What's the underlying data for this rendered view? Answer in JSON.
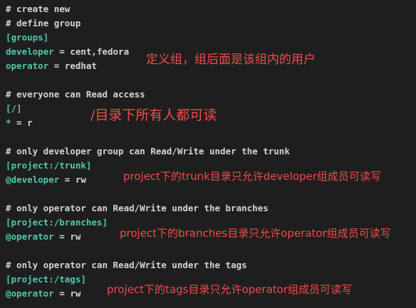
{
  "code": {
    "line_1": "# create new",
    "line_2": "# define group",
    "line_3": "[groups]",
    "line_4_key": "developer",
    "line_4_op": " = ",
    "line_4_val": "cent,fedora",
    "line_5_key": "operator",
    "line_5_op": " = ",
    "line_5_val": "redhat",
    "line_7": "# everyone can Read access",
    "line_8": "[/]",
    "line_9_key": "*",
    "line_9_op": " = ",
    "line_9_val": "r",
    "line_11": "# only developer group can Read/Write under the trunk",
    "line_12": "[project:/trunk]",
    "line_13_key": "@developer",
    "line_13_op": " = ",
    "line_13_val": "rw",
    "line_15": "# only operator can Read/Write under the branches",
    "line_16": "[project:/branches]",
    "line_17_key": "@operator",
    "line_17_op": " = ",
    "line_17_val": "rw",
    "line_19": "# only operator can Read/Write under the tags",
    "line_20": "[project:/tags]",
    "line_21_key": "@operator",
    "line_21_op": " = ",
    "line_21_val": "rw"
  },
  "annotations": {
    "groups_note": "定义组，组后面是该组内的用户",
    "root_note": "/目录下所有人都可读",
    "trunk_note": "project下的trunk目录只允许developer组成员可读写",
    "branches_note": "project下的branches目录只允许operator组成员可读写",
    "tags_note": "project下的tags目录只允许operator组成员可读写"
  },
  "colors": {
    "background": "#1e1e1e",
    "text": "#d4d4d4",
    "annotation": "#f14c4c"
  }
}
